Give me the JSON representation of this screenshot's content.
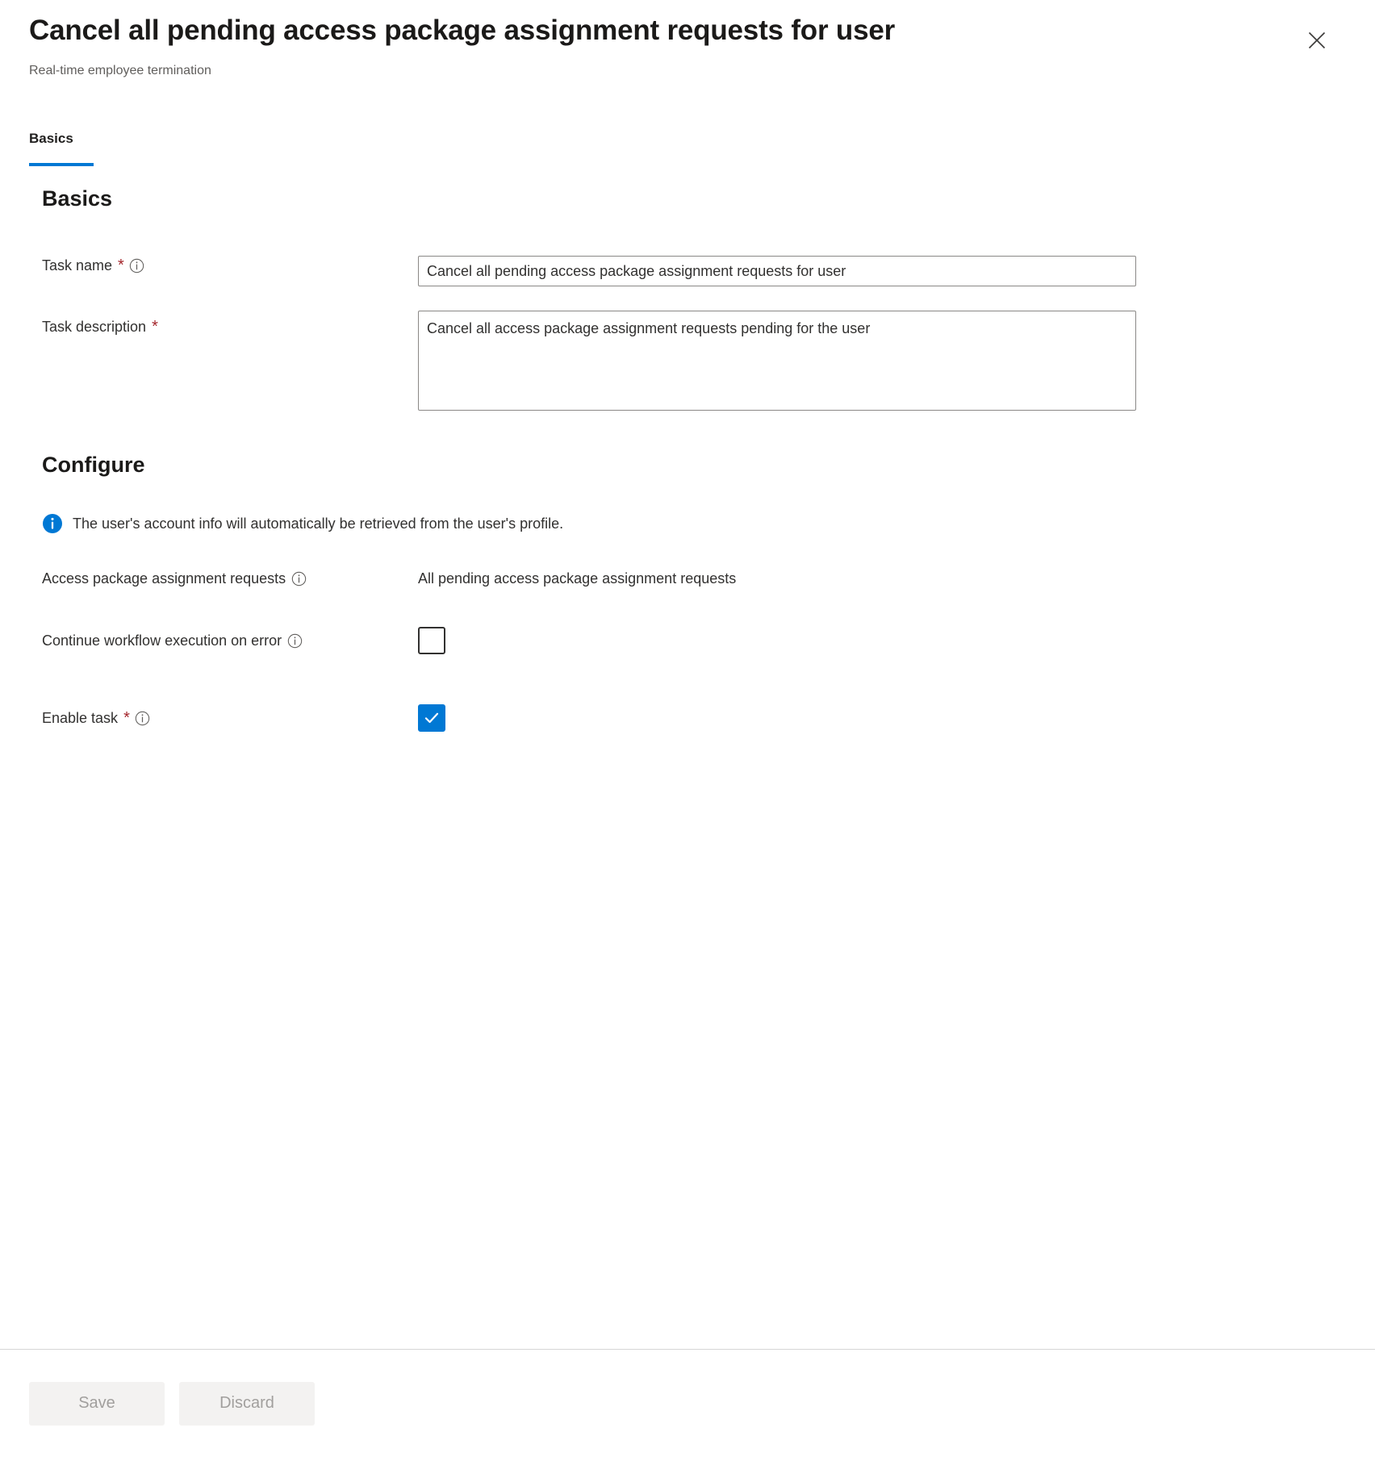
{
  "header": {
    "title": "Cancel all pending access package assignment requests for user",
    "subtitle": "Real-time employee termination",
    "close_icon": "close-icon",
    "accent_color": "#0078d4"
  },
  "tabs": [
    {
      "label": "Basics",
      "selected": true
    }
  ],
  "basics": {
    "heading": "Basics",
    "task_name": {
      "label": "Task name",
      "required_marker": "*",
      "info_icon": "info-circle-icon",
      "value": "Cancel all pending access package assignment requests for user",
      "placeholder": ""
    },
    "task_description": {
      "label": "Task description",
      "required_marker": "*",
      "value": "Cancel all access package assignment requests pending for the user",
      "placeholder": ""
    }
  },
  "configure": {
    "heading": "Configure",
    "info_banner": {
      "icon": "info-filled-icon",
      "text": "The user's account info will automatically be retrieved from the user's profile.",
      "color": "#0078d4"
    },
    "assignment_requests": {
      "label": "Access package assignment requests",
      "info_icon": "info-circle-icon",
      "value": "All pending access package assignment requests"
    },
    "continue_on_error": {
      "label": "Continue workflow execution on error",
      "info_icon": "info-circle-icon",
      "checked": false
    },
    "enable_task": {
      "label": "Enable task",
      "required_marker": "*",
      "info_icon": "info-circle-icon",
      "checked": true
    }
  },
  "footer": {
    "save_label": "Save",
    "discard_label": "Discard"
  }
}
